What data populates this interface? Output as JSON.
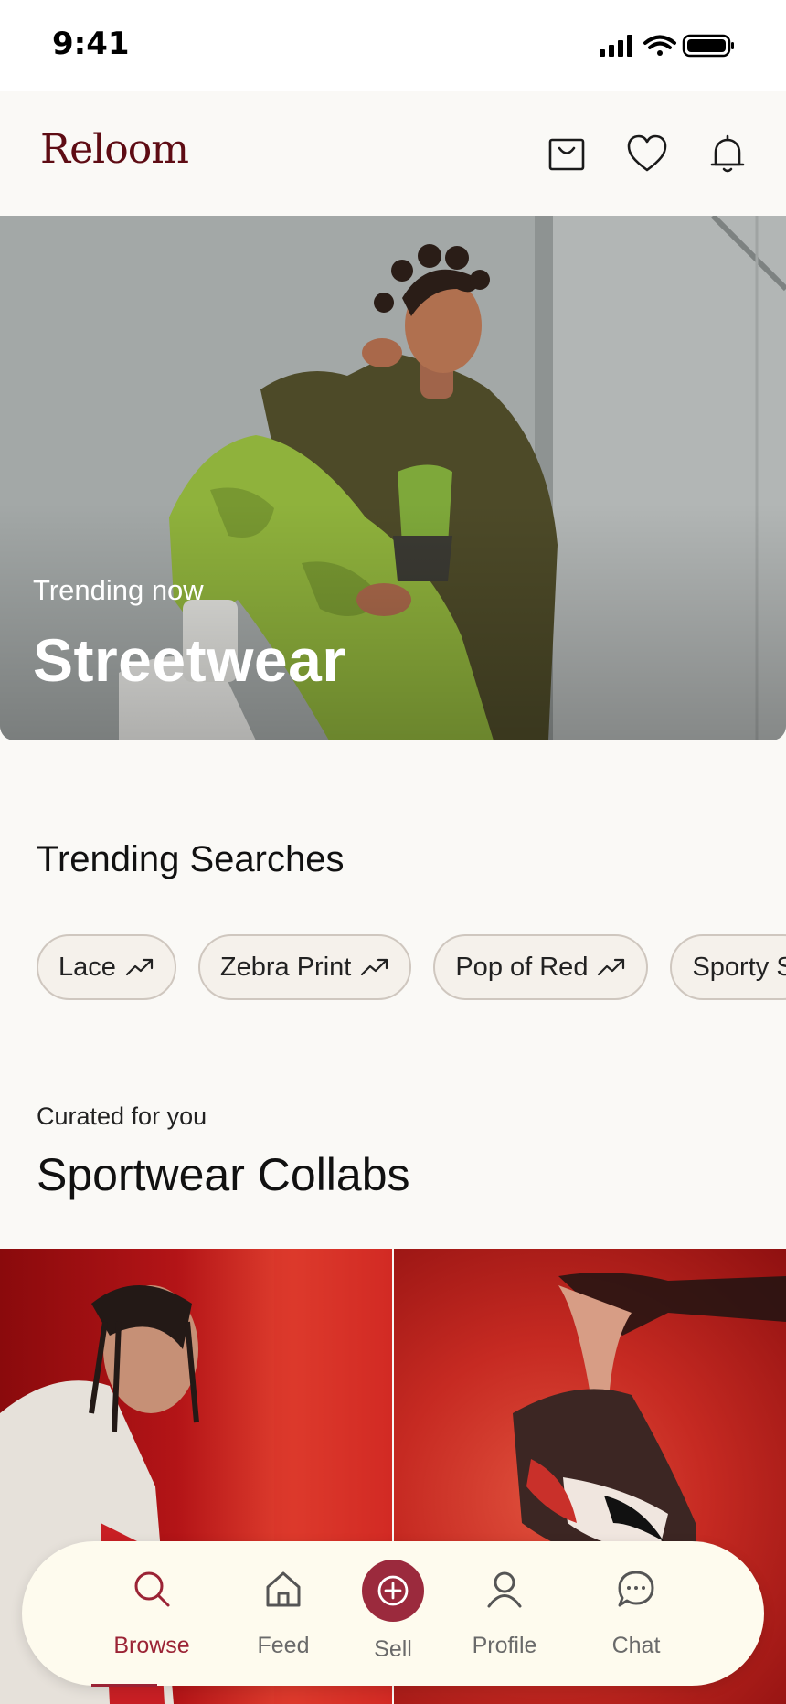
{
  "status_bar": {
    "time": "9:41"
  },
  "header": {
    "logo": "Reloom"
  },
  "hero": {
    "eyebrow": "Trending now",
    "title": "Streetwear"
  },
  "trending": {
    "title": "Trending Searches",
    "chips": [
      "Lace",
      "Zebra Print",
      "Pop of Red",
      "Sporty S"
    ]
  },
  "curated": {
    "eyebrow": "Curated for you",
    "title": "Sportwear Collabs"
  },
  "bottom_nav": {
    "items": [
      {
        "label": "Browse",
        "icon": "search-icon",
        "active": true
      },
      {
        "label": "Feed",
        "icon": "home-icon"
      },
      {
        "label": "Sell",
        "icon": "plus-circle-icon"
      },
      {
        "label": "Profile",
        "icon": "user-icon"
      },
      {
        "label": "Chat",
        "icon": "chat-bubble-icon"
      }
    ]
  },
  "colors": {
    "brand": "#5e0c14",
    "accent": "#9b2335",
    "nav_background": "#fefbee",
    "chip_border": "#cfc7bf"
  }
}
